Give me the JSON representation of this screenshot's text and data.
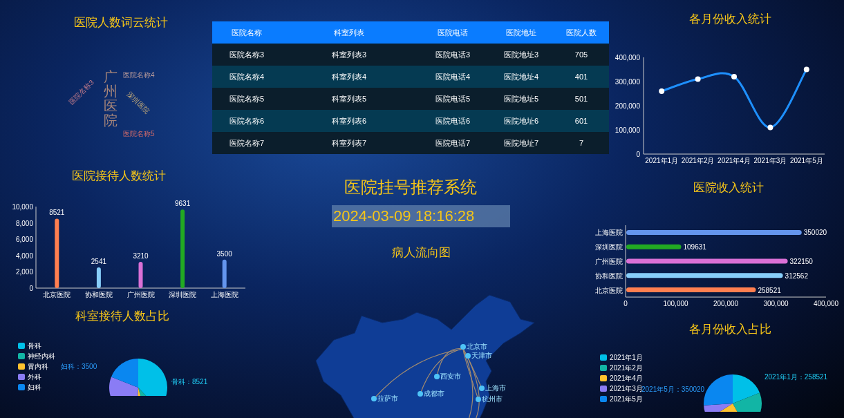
{
  "left": {
    "wordcloud": {
      "title": "医院人数词云统计",
      "words": [
        {
          "text": "广州医院",
          "kind": "vertical"
        },
        {
          "text": "医院名称4",
          "kind": "flat"
        },
        {
          "text": "深圳医院",
          "kind": "down"
        },
        {
          "text": "医院名称3",
          "kind": "up"
        },
        {
          "text": "医院名称5",
          "kind": "flat"
        }
      ]
    },
    "visits": {
      "title": "医院接待人数统计",
      "chart_data": {
        "type": "bar",
        "categories": [
          "北京医院",
          "协和医院",
          "广州医院",
          "深圳医院",
          "上海医院"
        ],
        "stacked": true,
        "series": [
          {
            "color": "#ff7f50",
            "values": [
              8521,
              null,
              null,
              null,
              null
            ]
          },
          {
            "color": "#87cefa",
            "values": [
              null,
              2541,
              null,
              null,
              null
            ]
          },
          {
            "color": "#da70d6",
            "values": [
              null,
              null,
              3210,
              null,
              null
            ]
          },
          {
            "color": "#22aa22",
            "values": [
              null,
              null,
              null,
              9631,
              null
            ]
          },
          {
            "color": "#6495ed",
            "values": [
              null,
              null,
              null,
              null,
              3500
            ]
          }
        ],
        "ylim": [
          0,
          10000
        ],
        "yticks": [
          0,
          {
            "value": 2000,
            "label": "2,000"
          },
          {
            "value": 4000,
            "label": "4,000"
          },
          {
            "value": 6000,
            "label": "6,000"
          },
          {
            "value": 8000,
            "label": "8,000"
          },
          {
            "value": 10000,
            "label": "10,000"
          }
        ],
        "data_labels": true
      }
    },
    "departments": {
      "title": "科室接待人数占比",
      "legend": [
        {
          "label": "骨科",
          "color": "#00c0e8"
        },
        {
          "label": "神经内科",
          "color": "#12b5a5"
        },
        {
          "label": "胃内科",
          "color": "#ffc22e"
        },
        {
          "label": "外科",
          "color": "#8a7cf5"
        },
        {
          "label": "妇科",
          "color": "#0a87f0"
        }
      ],
      "slice_labels": [
        "妇科：3500",
        "骨科：8521"
      ]
    }
  },
  "table": {
    "columns": [
      "医院名称",
      "科室列表",
      "医院电话",
      "医院地址",
      "医院人数"
    ],
    "rows": [
      [
        "医院名称3",
        "科室列表3",
        "医院电话3",
        "医院地址3",
        "705"
      ],
      [
        "医院名称4",
        "科室列表4",
        "医院电话4",
        "医院地址4",
        "401"
      ],
      [
        "医院名称5",
        "科室列表5",
        "医院电话5",
        "医院地址5",
        "501"
      ],
      [
        "医院名称6",
        "科室列表6",
        "医院电话6",
        "医院地址6",
        "601"
      ],
      [
        "医院名称7",
        "科室列表7",
        "医院电话7",
        "医院地址7",
        "7"
      ]
    ]
  },
  "center": {
    "title": "医院挂号推荐系统",
    "datetime": "2024-03-09 18:16:28",
    "map_title": "病人流向图",
    "cities": [
      "北京市",
      "天津市",
      "西安市",
      "成都市",
      "上海市",
      "杭州市",
      "拉萨市"
    ]
  },
  "right": {
    "monthly": {
      "title": "各月份收入统计",
      "chart_data": {
        "type": "line",
        "categories": [
          "2021年1月",
          "2021年2月",
          "2021年4月",
          "2021年3月",
          "2021年5月"
        ],
        "series": [
          {
            "color": "#1e90ff",
            "marker": true,
            "values": [
              260000,
              310000,
              320000,
              110000,
              350000
            ]
          }
        ],
        "ylim": [
          0,
          400000
        ],
        "yticks": [
          0,
          {
            "value": 100000,
            "label": "100,000"
          },
          {
            "value": 200000,
            "label": "200,000"
          },
          {
            "value": 300000,
            "label": "300,000"
          },
          {
            "value": 400000,
            "label": "400,000"
          }
        ]
      }
    },
    "income": {
      "title": "医院收入统计",
      "chart_data": {
        "type": "bar",
        "orientation": "horizontal",
        "stacked": true,
        "categories": [
          "上海医院",
          "深圳医院",
          "广州医院",
          "协和医院",
          "北京医院"
        ],
        "series": [
          {
            "color": "#6495ed",
            "values": [
              350020,
              null,
              null,
              null,
              null
            ]
          },
          {
            "color": "#22aa22",
            "values": [
              null,
              109631,
              null,
              null,
              null
            ]
          },
          {
            "color": "#da70d6",
            "values": [
              null,
              null,
              322150,
              null,
              null
            ]
          },
          {
            "color": "#87cefa",
            "values": [
              null,
              null,
              null,
              312562,
              null
            ]
          },
          {
            "color": "#ff7f50",
            "values": [
              null,
              null,
              null,
              null,
              258521
            ]
          }
        ],
        "xlim": [
          0,
          400000
        ],
        "xticks": [
          0,
          {
            "value": 100000,
            "label": "100,000"
          },
          {
            "value": 200000,
            "label": "200,000"
          },
          {
            "value": 300000,
            "label": "300,000"
          },
          {
            "value": 400000,
            "label": "400,000"
          }
        ],
        "data_labels": true
      }
    },
    "share": {
      "title": "各月份收入占比",
      "legend": [
        {
          "label": "2021年1月",
          "color": "#00c0e8"
        },
        {
          "label": "2021年2月",
          "color": "#12b5a5"
        },
        {
          "label": "2021年4月",
          "color": "#ffc22e"
        },
        {
          "label": "2021年3月",
          "color": "#8a7cf5"
        },
        {
          "label": "2021年5月",
          "color": "#0a87f0"
        }
      ],
      "slice_labels": [
        "2021年5月：350020",
        "2021年1月：258521"
      ]
    }
  }
}
